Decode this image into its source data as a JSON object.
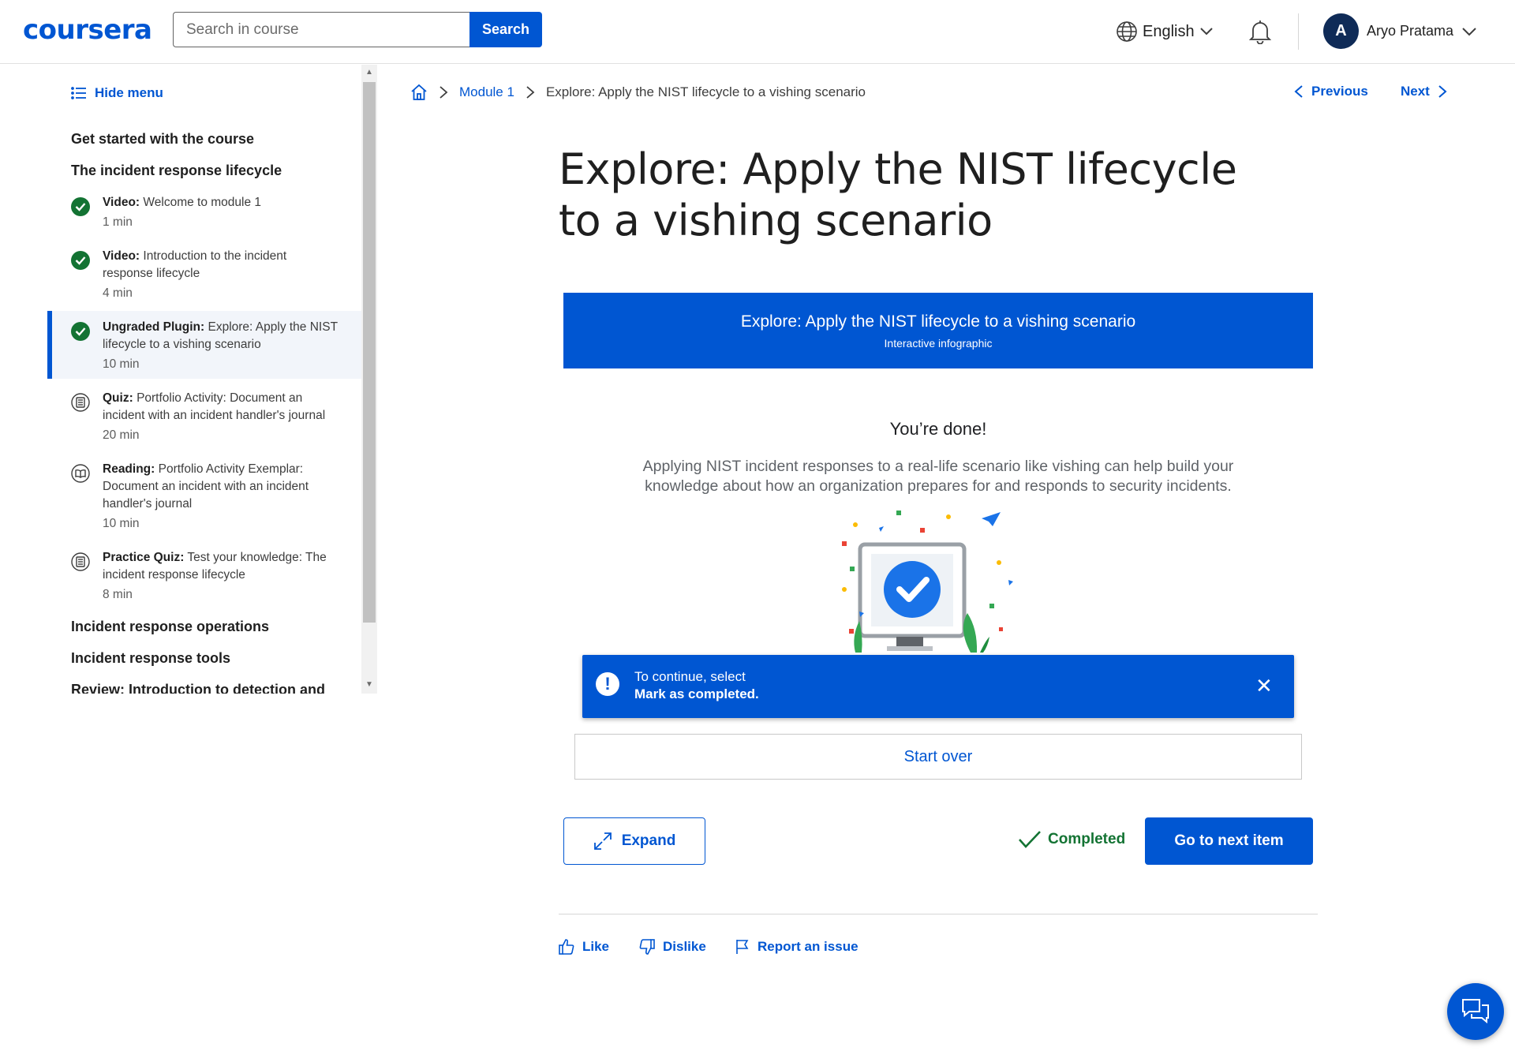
{
  "header": {
    "logo": "coursera",
    "search_placeholder": "Search in course",
    "search_button": "Search",
    "language": "English",
    "user_initial": "A",
    "user_name": "Aryo Pratama"
  },
  "sidebar": {
    "hide_menu": "Hide menu",
    "sections": [
      "Get started with the course",
      "The incident response lifecycle",
      "Incident response operations",
      "Incident response tools",
      "Review: Introduction to detection and"
    ],
    "items": [
      {
        "type": "Video:",
        "title": "Welcome to module 1",
        "title_l2": "",
        "title_l3": "",
        "meta": "1 min",
        "status": "completed"
      },
      {
        "type": "Video:",
        "title": "Introduction to the incident",
        "title_l2": "response lifecycle",
        "title_l3": "",
        "meta": "4 min",
        "status": "completed"
      },
      {
        "type": "Ungraded Plugin:",
        "title": "Explore: Apply the NIST",
        "title_l2": "lifecycle to a vishing scenario",
        "title_l3": "",
        "meta": "10 min",
        "status": "completed"
      },
      {
        "type": "Quiz:",
        "title": "Portfolio Activity: Document an",
        "title_l2": "incident with an incident handler's journal",
        "title_l3": "",
        "meta": "20 min",
        "status": "quiz"
      },
      {
        "type": "Reading:",
        "title": "Portfolio Activity Exemplar:",
        "title_l2": "Document an incident with an incident",
        "title_l3": "handler's journal",
        "meta": "10 min",
        "status": "reading"
      },
      {
        "type": "Practice Quiz:",
        "title": "Test your knowledge: The",
        "title_l2": "incident response lifecycle",
        "title_l3": "",
        "meta": "8 min",
        "status": "quiz"
      }
    ]
  },
  "breadcrumb": {
    "module": "Module 1",
    "current": "Explore: Apply the NIST lifecycle to a vishing scenario"
  },
  "nav": {
    "previous": "Previous",
    "next": "Next"
  },
  "page_title": "Explore: Apply the NIST lifecycle to a vishing scenario",
  "plugin": {
    "banner_title": "Explore: Apply the NIST lifecycle to a vishing scenario",
    "banner_subtitle": "Interactive infographic",
    "done_title": "You’re done!",
    "done_text": "Applying NIST incident responses to a real-life scenario like vishing can help build your knowledge about how an organization prepares for and responds to security incidents.",
    "start_over": "Start over"
  },
  "toast": {
    "line1": "To continue, select",
    "line2": "Mark as completed."
  },
  "actions": {
    "expand": "Expand",
    "completed": "Completed",
    "go_next": "Go to next item"
  },
  "feedback": {
    "like": "Like",
    "dislike": "Dislike",
    "report": "Report an issue"
  },
  "colors": {
    "brand": "#0056d2",
    "success": "#137333"
  }
}
